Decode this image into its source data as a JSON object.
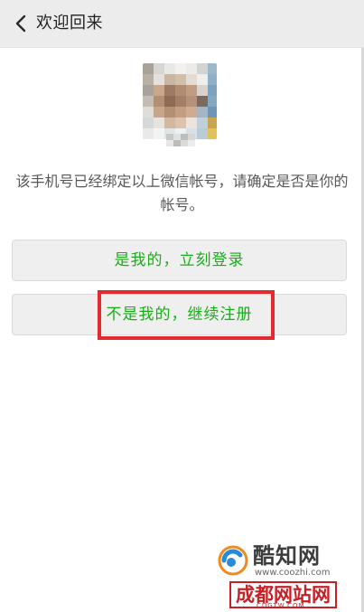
{
  "header": {
    "back_icon": "chevron-left-icon",
    "title": "欢迎回来"
  },
  "account": {
    "avatar_alt": "",
    "nickname": "",
    "message": "该手机号已经绑定以上微信帐号，请确定是否是你的帐号。"
  },
  "actions": {
    "login_label": "是我的，立刻登录",
    "register_label": "不是我的，继续注册"
  },
  "watermarks": {
    "primary_name": "酷知网",
    "primary_url": "www.coozhi.com",
    "secondary_name": "成都网站网",
    "secondary_url": "CDGTW.COM"
  },
  "colors": {
    "accent_green": "#1aad19",
    "highlight_red": "#e22a2f",
    "topbar_bg": "#ececec"
  }
}
